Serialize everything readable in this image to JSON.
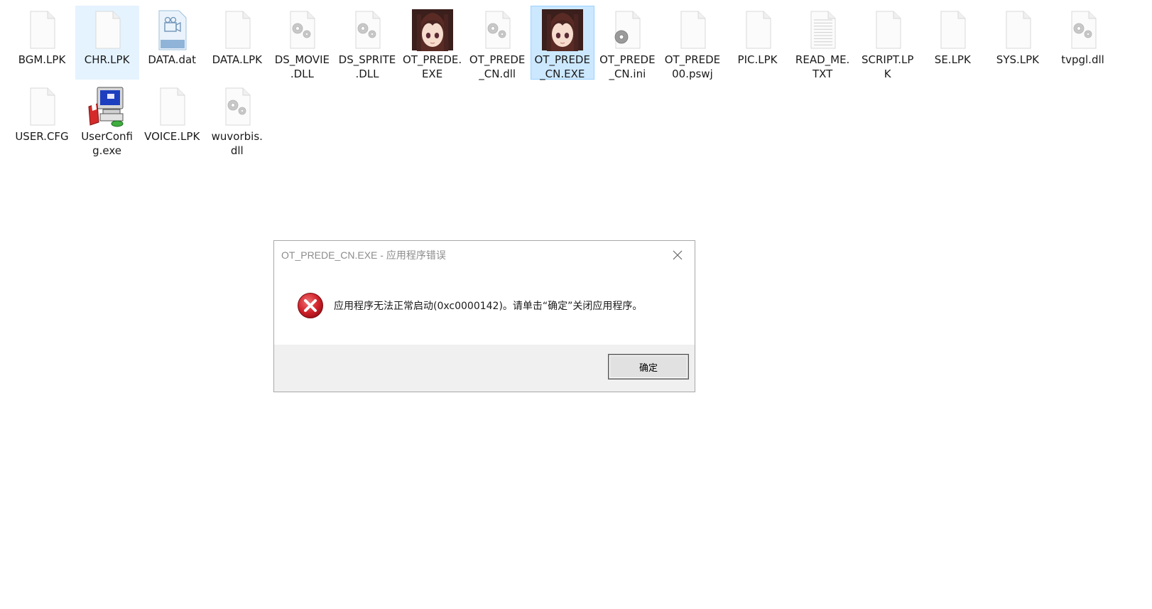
{
  "files": [
    {
      "name": "BGM.LPK",
      "icon": "blank-file-icon",
      "state": ""
    },
    {
      "name": "CHR.LPK",
      "icon": "blank-file-icon",
      "state": "hover"
    },
    {
      "name": "DATA.dat",
      "icon": "video-file-icon",
      "state": ""
    },
    {
      "name": "DATA.LPK",
      "icon": "blank-file-icon",
      "state": ""
    },
    {
      "name": "DS_MOVIE\n.DLL",
      "icon": "dll-gear-icon",
      "state": ""
    },
    {
      "name": "DS_SPRITE\n.DLL",
      "icon": "dll-gear-icon",
      "state": ""
    },
    {
      "name": "OT_PREDE.\nEXE",
      "icon": "anime-girl-app-icon",
      "state": ""
    },
    {
      "name": "OT_PREDE\n_CN.dll",
      "icon": "dll-gear-icon",
      "state": ""
    },
    {
      "name": "OT_PREDE\n_CN.EXE",
      "icon": "anime-girl-app-icon",
      "state": "selected"
    },
    {
      "name": "OT_PREDE\n_CN.ini",
      "icon": "ini-settings-icon",
      "state": ""
    },
    {
      "name": "OT_PREDE\n00.pswj",
      "icon": "blank-file-icon",
      "state": ""
    },
    {
      "name": "PIC.LPK",
      "icon": "blank-file-icon",
      "state": ""
    },
    {
      "name": "READ_ME.\nTXT",
      "icon": "text-file-icon",
      "state": ""
    },
    {
      "name": "SCRIPT.LP\nK",
      "icon": "blank-file-icon",
      "state": ""
    },
    {
      "name": "SE.LPK",
      "icon": "blank-file-icon",
      "state": ""
    },
    {
      "name": "SYS.LPK",
      "icon": "blank-file-icon",
      "state": ""
    },
    {
      "name": "tvpgl.dll",
      "icon": "dll-gear-icon",
      "state": ""
    },
    {
      "name": "USER.CFG",
      "icon": "blank-file-icon",
      "state": ""
    },
    {
      "name": "UserConfi\ng.exe",
      "icon": "installer-app-icon",
      "state": ""
    },
    {
      "name": "VOICE.LPK",
      "icon": "blank-file-icon",
      "state": ""
    },
    {
      "name": "wuvorbis.\ndll",
      "icon": "dll-gear-icon",
      "state": ""
    }
  ],
  "dialog": {
    "title": "OT_PREDE_CN.EXE - 应用程序错误",
    "message": "应用程序无法正常启动(0xc0000142)。请单击“确定”关闭应用程序。",
    "ok_label": "确定",
    "icon": "error-icon",
    "close_icon": "close-icon"
  },
  "colors": {
    "selected_bg": "#cce8ff",
    "selected_border": "#99d1ff",
    "hover_bg": "#e5f3ff",
    "error_red": "#c8102e",
    "dialog_footer": "#f0f0f0"
  }
}
